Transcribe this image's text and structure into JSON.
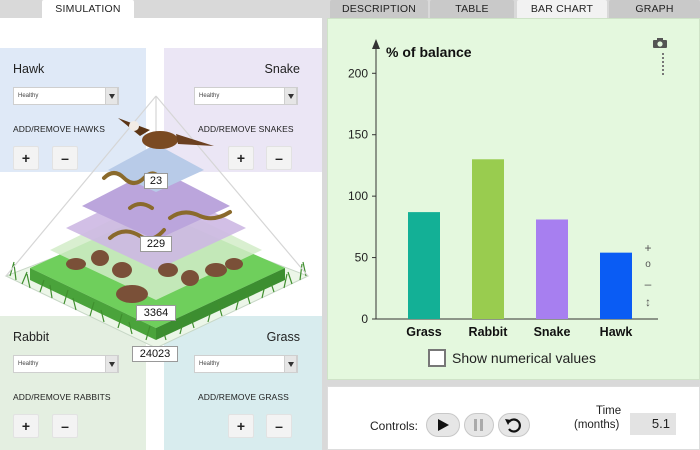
{
  "tabs": {
    "simulation": "SIMULATION",
    "description": "DESCRIPTION",
    "table": "TABLE",
    "bar_chart": "BAR CHART",
    "graph": "GRAPH"
  },
  "hawk": {
    "title": "Hawk",
    "status": "Healthy",
    "add_remove": "ADD/REMOVE HAWKS",
    "count": "23"
  },
  "snake": {
    "title": "Snake",
    "status": "Healthy",
    "add_remove": "ADD/REMOVE SNAKES",
    "count": "229"
  },
  "rabbit": {
    "title": "Rabbit",
    "status": "Healthy",
    "add_remove": "ADD/REMOVE RABBITS",
    "count": "3364"
  },
  "grass": {
    "title": "Grass",
    "status": "Healthy",
    "add_remove": "ADD/REMOVE GRASS",
    "count": "24023"
  },
  "buttons": {
    "plus": "+",
    "minus": "–"
  },
  "chart_data": {
    "type": "bar",
    "ylabel": "% of balance",
    "ylim": [
      0,
      210
    ],
    "yticks": [
      0,
      50,
      100,
      150,
      200
    ],
    "categories": [
      "Grass",
      "Rabbit",
      "Snake",
      "Hawk"
    ],
    "values": [
      87,
      130,
      81,
      54
    ],
    "colors": [
      "#13b096",
      "#99cc4f",
      "#a77ff0",
      "#0a5cf4"
    ],
    "zoom_controls": [
      "+",
      "o",
      "–",
      "↕"
    ]
  },
  "show_values_label": "Show numerical values",
  "controls": {
    "label": "Controls:",
    "time_label_line1": "Time",
    "time_label_line2": "(months)",
    "time_value": "5.1"
  }
}
